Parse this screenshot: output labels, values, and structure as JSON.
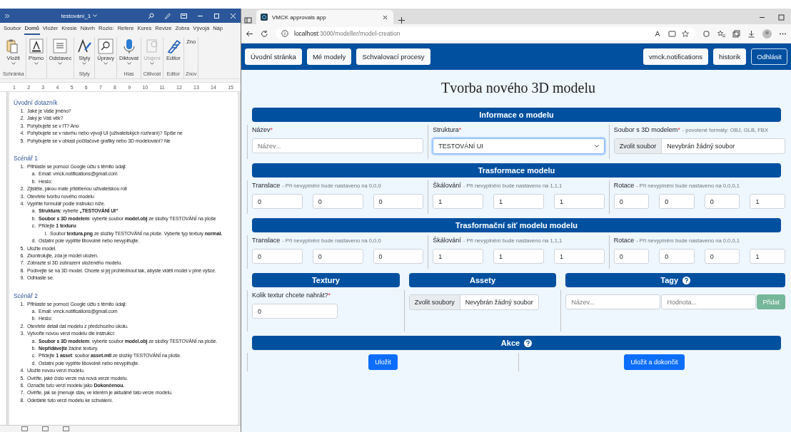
{
  "word": {
    "title": "testování_1",
    "tabs": [
      {
        "label": "Soubor",
        "selected": false
      },
      {
        "label": "Domů",
        "selected": true
      },
      {
        "label": "Vložer",
        "selected": false
      },
      {
        "label": "Kresle",
        "selected": false
      },
      {
        "label": "Návrh",
        "selected": false
      },
      {
        "label": "Rozlo:",
        "selected": false
      },
      {
        "label": "Refere",
        "selected": false
      },
      {
        "label": "Kores",
        "selected": false
      },
      {
        "label": "Revize",
        "selected": false
      },
      {
        "label": "Zobra",
        "selected": false
      },
      {
        "label": "Vývojá",
        "selected": false
      },
      {
        "label": "Náp",
        "selected": false
      }
    ],
    "ribbon_groups": [
      {
        "label": "Schránka",
        "tools": [
          {
            "kind": "paste",
            "label": "Vložit",
            "dropdown": true,
            "disabled": false
          }
        ]
      },
      {
        "tools": [
          {
            "kind": "font",
            "label": "Písmo",
            "dropdown": true,
            "disabled": false
          }
        ]
      },
      {
        "tools": [
          {
            "kind": "paragraph",
            "label": "Odstavec",
            "dropdown": true,
            "disabled": false
          }
        ]
      },
      {
        "label": "Styly",
        "tools": [
          {
            "kind": "styles",
            "label": "Styly",
            "dropdown": true,
            "disabled": false
          }
        ]
      },
      {
        "tools": [
          {
            "kind": "search",
            "label": "Úpravy",
            "dropdown": true,
            "disabled": false
          }
        ]
      },
      {
        "label": "Hlas",
        "tools": [
          {
            "kind": "mic",
            "label": "Diktovat",
            "dropdown": true,
            "disabled": false
          }
        ]
      },
      {
        "label": "Citlivost",
        "tools": [
          {
            "kind": "sensitivity",
            "label": "Utajení",
            "dropdown": true,
            "disabled": true
          }
        ]
      },
      {
        "label": "Editor",
        "tools": [
          {
            "kind": "editor",
            "label": "Editor",
            "dropdown": false,
            "disabled": false
          }
        ]
      },
      {
        "label": "Znov",
        "tools": [
          {
            "kind": "plain",
            "label": "Zno",
            "dropdown": false,
            "disabled": false
          }
        ]
      }
    ],
    "ruler": [
      "1",
      "2",
      "3",
      "4",
      "5",
      "6",
      "7",
      "8",
      "9",
      "10",
      "11",
      "12",
      "13",
      "14",
      "15"
    ],
    "sections": [
      {
        "heading": "Úvodní dotazník",
        "items": [
          {
            "marker": "1.",
            "text": "Jaké je Vaše jméno?"
          },
          {
            "marker": "2.",
            "text": "Jaký je Váš věk?"
          },
          {
            "marker": "3.",
            "text": "Pohybujete se v IT? Ano"
          },
          {
            "marker": "4.",
            "text": "Pohybujete se v návrhu nebo vývoji UI (uživatelských rozhraní)? Spíše ne"
          },
          {
            "marker": "5.",
            "text": "Pohybujete se v oblast počítačové grafiky nebo 3D modelování? Ne"
          }
        ]
      },
      {
        "heading": "Scénář 1",
        "items": [
          {
            "marker": "1.",
            "text": "Přihlaste se pomocí Google účtu s těmito údaji:",
            "children": [
              {
                "marker": "a.",
                "text": "Email: vmck.notifications@gmail.com"
              },
              {
                "marker": "b.",
                "text": "Heslo:"
              }
            ]
          },
          {
            "marker": "2.",
            "text": "Zjistěte, jakou mate přidělenou uživatelskou roli"
          },
          {
            "marker": "3.",
            "text": "Otevřete tvorbu nového modelu"
          },
          {
            "marker": "4.",
            "text": "Vyplňte formulář podle instrukcí níže.",
            "children": [
              {
                "marker": "a.",
                "text": "**Struktura:** vyberte **„TESTOVÁNÍ UI“**"
              },
              {
                "marker": "b.",
                "text": "**Soubor s 3D modelem**: vyberte soubor **model.obj** ze složky TESTOVÁNÍ na ploše"
              },
              {
                "marker": "c.",
                "text": "Přidejte **1 texturu**",
                "children": [
                  {
                    "marker": "i.",
                    "text": "Soubor **textura.png** ze složky TESTOVÁNÍ na ploše. Vyberte typ textury **normal.**"
                  }
                ]
              },
              {
                "marker": "d.",
                "text": "Ostatní pole vyplňte libovolně nebo nevyplňujte."
              }
            ]
          },
          {
            "marker": "5.",
            "text": "Uložte model."
          },
          {
            "marker": "6.",
            "text": "Zkontrolujte, zda je model uložen."
          },
          {
            "marker": "7.",
            "text": "Zobrazte si 3D zobrazení uloženého modelu."
          },
          {
            "marker": "8.",
            "text": "Podívejte se na 3D model. Chcete si jej prohlédnout tak, abyste viděli model v plné výšce."
          },
          {
            "marker": "9.",
            "text": "Odhlaste se."
          }
        ]
      },
      {
        "heading": "Scénář 2",
        "items": [
          {
            "marker": "1.",
            "text": "Přihlaste se pomocí Google účtu s těmito údaji:",
            "children": [
              {
                "marker": "a.",
                "text": "Email: vmck.notifications@gmail.com"
              },
              {
                "marker": "b.",
                "text": "Heslo:"
              }
            ]
          },
          {
            "marker": "2.",
            "text": "Otevřete detail dat modelu z předchozího úkolu."
          },
          {
            "marker": "3.",
            "text": "Vytvořte novou verzi modelu dle instrukcí:",
            "children": [
              {
                "marker": "a.",
                "text": "**Soubor s 3D modelem**: vyberte soubor **model.obj** ze složky TESTOVÁNÍ na ploše."
              },
              {
                "marker": "b.",
                "text": "**Nepřidávejte** žádné textury."
              },
              {
                "marker": "c.",
                "text": "Přidejte **1 asset**: soubor **asset.mtl** ze složky TESTOVÁNÍ na ploše."
              },
              {
                "marker": "d.",
                "text": "Ostatní pole vyplňte libovolně nebo nevyplňujte."
              }
            ]
          },
          {
            "marker": "4.",
            "text": "Uložte novou verzi modelu."
          },
          {
            "marker": "5.",
            "text": "Ověřte, jaké číslo verze má nová verze modelu."
          },
          {
            "marker": "6.",
            "text": "Označte tuto verzi modelu jako **Dokončenou.**"
          },
          {
            "marker": "7.",
            "text": "Ověřte, jak se jmenuje stav, ve kterém je aktuálně tato verze modelu."
          },
          {
            "marker": "8.",
            "text": "Odešlete tuto verzi modelu ke schválení."
          }
        ]
      }
    ]
  },
  "browser": {
    "tab_title": "VMCK approvals app",
    "url_host": "localhost",
    "url_path": ":3000/modeller/model-creation",
    "nav_left": [
      {
        "label": "Úvodní stránka",
        "kind": "light"
      },
      {
        "label": "Mé modely",
        "kind": "light"
      },
      {
        "label": "Schvalovací procesy",
        "kind": "light"
      }
    ],
    "nav_right": [
      {
        "label": "vmck.notifications",
        "kind": "light"
      },
      {
        "label": "historik",
        "kind": "light"
      },
      {
        "label": "Odhlásit",
        "kind": "outline"
      }
    ],
    "form": {
      "title": "Tvorba nového 3D modelu",
      "rows": [
        {
          "kind": "wide",
          "title": "Informace o modelu",
          "columns": [
            {
              "label": "Název",
              "asterisk": "*",
              "controls": [
                {
                  "kind": "text",
                  "placeholder": "Název..."
                }
              ]
            },
            {
              "label": "Struktura",
              "asterisk": "*",
              "controls": [
                {
                  "kind": "select",
                  "value": "TESTOVÁNÍ UI",
                  "focused": true
                }
              ]
            },
            {
              "label": "Soubor s 3D modelem",
              "asterisk": "*",
              "hint": "- povolené formáty: OBJ, GLB, FBX",
              "controls": [
                {
                  "kind": "file",
                  "button": "Zvolit soubor",
                  "value": "Nevybrán žádný soubor"
                }
              ]
            }
          ]
        },
        {
          "kind": "wide",
          "title": "Trasformace modelu",
          "columns": [
            {
              "label": "Translace",
              "hint": "- Při nevyplnění bude nastaveno na 0,0,0",
              "controls": [
                {
                  "kind": "text",
                  "value": "0"
                },
                {
                  "kind": "text",
                  "value": "0"
                },
                {
                  "kind": "text",
                  "value": "0"
                }
              ]
            },
            {
              "label": "Škálování",
              "hint": "- Při nevyplnění bude nastaveno na 1,1,1",
              "controls": [
                {
                  "kind": "text",
                  "value": "1"
                },
                {
                  "kind": "text",
                  "value": "1"
                },
                {
                  "kind": "text",
                  "value": "1"
                }
              ]
            },
            {
              "label": "Rotace",
              "hint": "- Při nevyplnění bude nastaveno na 0,0,0,1",
              "controls": [
                {
                  "kind": "text",
                  "value": "0"
                },
                {
                  "kind": "text",
                  "value": "0"
                },
                {
                  "kind": "text",
                  "value": "0"
                },
                {
                  "kind": "text",
                  "value": "1"
                }
              ]
            }
          ]
        },
        {
          "kind": "wide",
          "title": "Trasformační síť modelu modelu",
          "columns": [
            {
              "label": "Translace",
              "hint": "- Při nevyplnění bude nastaveno na 0,0,0",
              "controls": [
                {
                  "kind": "text",
                  "value": "0"
                },
                {
                  "kind": "text",
                  "value": "0"
                },
                {
                  "kind": "text",
                  "value": "0"
                }
              ]
            },
            {
              "label": "Škálování",
              "hint": "- Při nevyplnění bude nastaveno na 1,1,1",
              "controls": [
                {
                  "kind": "text",
                  "value": "1"
                },
                {
                  "kind": "text",
                  "value": "1"
                },
                {
                  "kind": "text",
                  "value": "1"
                }
              ]
            },
            {
              "label": "Rotace",
              "hint": "- Při nevyplnění bude nastaveno na 0,0,0,1",
              "controls": [
                {
                  "kind": "text",
                  "value": "0"
                },
                {
                  "kind": "text",
                  "value": "0"
                },
                {
                  "kind": "text",
                  "value": "0"
                },
                {
                  "kind": "text",
                  "value": "1"
                }
              ]
            }
          ]
        },
        {
          "kind": "split",
          "panels": [
            {
              "title": "Textury",
              "help": false,
              "label": "Kolik textur chcete nahrát?",
              "asterisk": "*",
              "controls": [
                {
                  "kind": "number",
                  "value": "0"
                }
              ]
            },
            {
              "title": "Assety",
              "help": false,
              "controls": [
                {
                  "kind": "files",
                  "button": "Zvolit soubory",
                  "value": "Nevybrán žádný soubor"
                }
              ]
            },
            {
              "title": "Tagy",
              "help": true,
              "controls": [
                {
                  "kind": "text",
                  "placeholder": "Název..."
                },
                {
                  "kind": "text",
                  "placeholder": "Hodnota..."
                },
                {
                  "kind": "button",
                  "label": "Přidat",
                  "disabled": true
                }
              ]
            }
          ]
        },
        {
          "kind": "actions",
          "title": "Akce",
          "help": true,
          "buttons": [
            "Uložit",
            "Uložit a dokončit"
          ]
        }
      ]
    }
  }
}
